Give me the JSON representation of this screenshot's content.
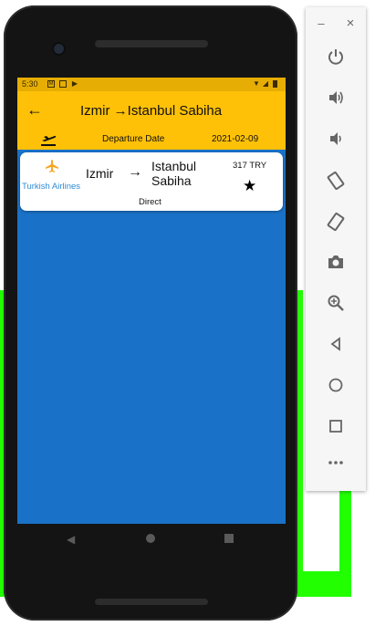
{
  "status_bar": {
    "time": "5:30"
  },
  "app_bar": {
    "back_icon": "arrow-back-icon",
    "title": "Izmir →Istanbul Sabiha",
    "departure_label": "Departure Date",
    "departure_date": "2021-02-09"
  },
  "flights": [
    {
      "airline": "Turkish Airlines",
      "from": "Izmir",
      "to": "Istanbul Sabiha",
      "arrow": "→",
      "price": "317 TRY",
      "stops": "Direct",
      "favorite": true
    }
  ],
  "colors": {
    "app_bar": "#ffc107",
    "status_bar": "#e6ae05",
    "screen_background": "#1a72c8",
    "airline_name": "#2f8cd6",
    "airline_icon": "#f5a623"
  },
  "emulator_toolbar": {
    "minimize": "–",
    "close": "×",
    "buttons": [
      "power-icon",
      "volume-up-icon",
      "volume-down-icon",
      "rotate-left-icon",
      "rotate-right-icon",
      "camera-icon",
      "zoom-icon",
      "back-icon",
      "home-icon",
      "overview-icon",
      "more-icon"
    ]
  }
}
